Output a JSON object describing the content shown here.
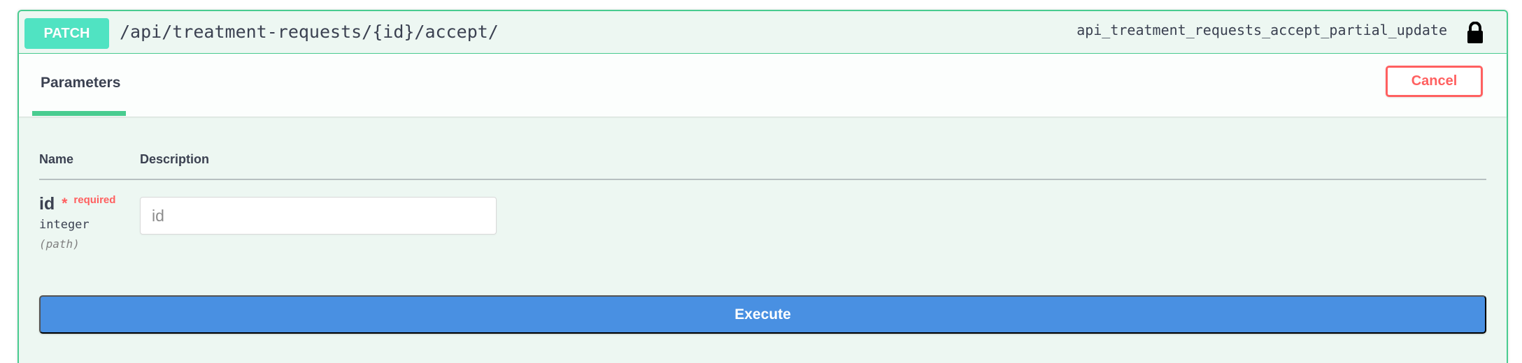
{
  "operation": {
    "method": "PATCH",
    "path": "/api/treatment-requests/{id}/accept/",
    "operation_id": "api_treatment_requests_accept_partial_update",
    "lock_icon": "lock-icon"
  },
  "section": {
    "tab_label": "Parameters",
    "cancel_label": "Cancel"
  },
  "table": {
    "headers": [
      "Name",
      "Description"
    ]
  },
  "parameter": {
    "name": "id",
    "required_mark": "*",
    "required_label": "required",
    "type": "integer",
    "location": "(path)",
    "placeholder": "id"
  },
  "actions": {
    "execute_label": "Execute"
  },
  "colors": {
    "method_badge": "#50e3c2",
    "border": "#49cc90",
    "panel_bg": "#edf7f2",
    "cancel": "#ff6060",
    "execute": "#4990e2"
  }
}
